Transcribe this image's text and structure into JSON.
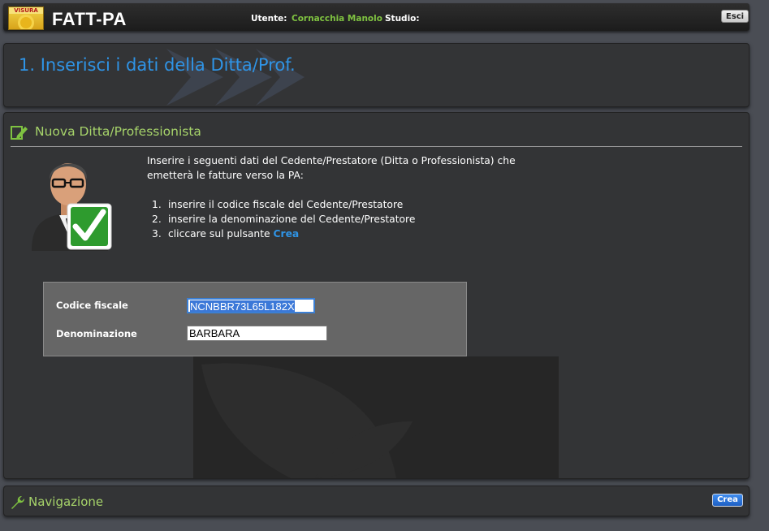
{
  "header": {
    "logo_text": "VISURA",
    "app_title": "FATT-PA",
    "user_label": "Utente:",
    "user_name": "Cornacchia Manolo",
    "studio_label": "Studio:",
    "logout_label": "Esci"
  },
  "step": {
    "title": "1. Inserisci i dati della Ditta/Prof."
  },
  "section": {
    "title": "Nuova Ditta/Professionista",
    "intro": "Inserire i seguenti dati del Cedente/Prestatore (Ditta o Professionista) che emetterà le fatture verso la PA:",
    "steps": [
      {
        "num": "1.",
        "text": "inserire il codice fiscale del Cedente/Prestatore"
      },
      {
        "num": "2.",
        "text": "inserire la denominazione del Cedente/Prestatore"
      },
      {
        "num": "3.",
        "text": "cliccare sul pulsante ",
        "link": "Crea"
      }
    ]
  },
  "form": {
    "codice_fiscale_label": "Codice fiscale",
    "codice_fiscale_value": "NCNBBR73L65L182X",
    "denominazione_label": "Denominazione",
    "denominazione_value": "BARBARA"
  },
  "nav": {
    "title": "Navigazione",
    "create_label": "Crea"
  },
  "colors": {
    "accent_blue": "#2f94e6",
    "accent_green": "#a6d36a",
    "user_green": "#7fc241"
  },
  "icons": {
    "section": "edit-icon",
    "nav": "wrench-icon",
    "avatar": "user-check-icon"
  }
}
